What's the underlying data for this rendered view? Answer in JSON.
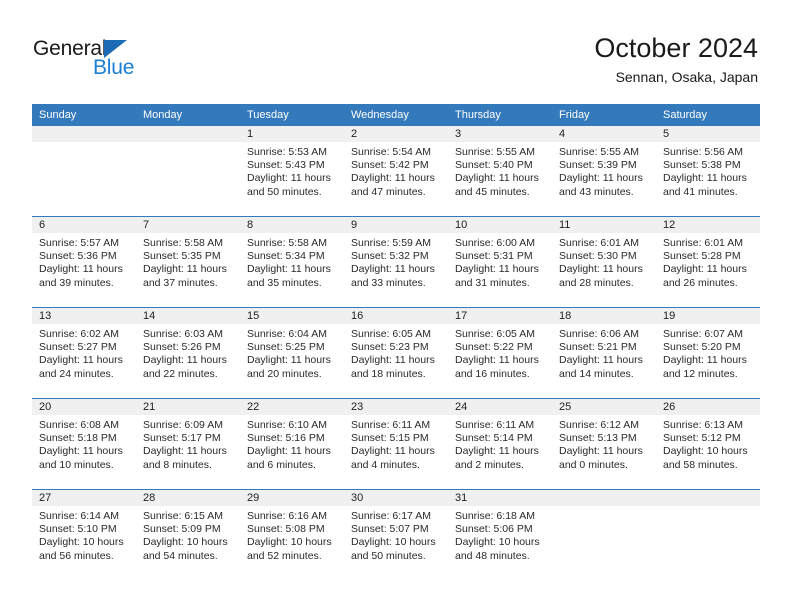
{
  "brand": {
    "name_top": "General",
    "name_bottom": "Blue",
    "triangle_color": "#1c6cb5",
    "bottom_color": "#1c7fd4"
  },
  "header": {
    "title": "October 2024",
    "subtitle": "Sennan, Osaka, Japan",
    "accent_color": "#3379bb",
    "daynum_band_color": "#f0f0f0"
  },
  "weekdays": [
    "Sunday",
    "Monday",
    "Tuesday",
    "Wednesday",
    "Thursday",
    "Friday",
    "Saturday"
  ],
  "weeks": [
    [
      {
        "day": "",
        "lines": []
      },
      {
        "day": "",
        "lines": []
      },
      {
        "day": "1",
        "lines": [
          "Sunrise: 5:53 AM",
          "Sunset: 5:43 PM",
          "Daylight: 11 hours",
          "and 50 minutes."
        ]
      },
      {
        "day": "2",
        "lines": [
          "Sunrise: 5:54 AM",
          "Sunset: 5:42 PM",
          "Daylight: 11 hours",
          "and 47 minutes."
        ]
      },
      {
        "day": "3",
        "lines": [
          "Sunrise: 5:55 AM",
          "Sunset: 5:40 PM",
          "Daylight: 11 hours",
          "and 45 minutes."
        ]
      },
      {
        "day": "4",
        "lines": [
          "Sunrise: 5:55 AM",
          "Sunset: 5:39 PM",
          "Daylight: 11 hours",
          "and 43 minutes."
        ]
      },
      {
        "day": "5",
        "lines": [
          "Sunrise: 5:56 AM",
          "Sunset: 5:38 PM",
          "Daylight: 11 hours",
          "and 41 minutes."
        ]
      }
    ],
    [
      {
        "day": "6",
        "lines": [
          "Sunrise: 5:57 AM",
          "Sunset: 5:36 PM",
          "Daylight: 11 hours",
          "and 39 minutes."
        ]
      },
      {
        "day": "7",
        "lines": [
          "Sunrise: 5:58 AM",
          "Sunset: 5:35 PM",
          "Daylight: 11 hours",
          "and 37 minutes."
        ]
      },
      {
        "day": "8",
        "lines": [
          "Sunrise: 5:58 AM",
          "Sunset: 5:34 PM",
          "Daylight: 11 hours",
          "and 35 minutes."
        ]
      },
      {
        "day": "9",
        "lines": [
          "Sunrise: 5:59 AM",
          "Sunset: 5:32 PM",
          "Daylight: 11 hours",
          "and 33 minutes."
        ]
      },
      {
        "day": "10",
        "lines": [
          "Sunrise: 6:00 AM",
          "Sunset: 5:31 PM",
          "Daylight: 11 hours",
          "and 31 minutes."
        ]
      },
      {
        "day": "11",
        "lines": [
          "Sunrise: 6:01 AM",
          "Sunset: 5:30 PM",
          "Daylight: 11 hours",
          "and 28 minutes."
        ]
      },
      {
        "day": "12",
        "lines": [
          "Sunrise: 6:01 AM",
          "Sunset: 5:28 PM",
          "Daylight: 11 hours",
          "and 26 minutes."
        ]
      }
    ],
    [
      {
        "day": "13",
        "lines": [
          "Sunrise: 6:02 AM",
          "Sunset: 5:27 PM",
          "Daylight: 11 hours",
          "and 24 minutes."
        ]
      },
      {
        "day": "14",
        "lines": [
          "Sunrise: 6:03 AM",
          "Sunset: 5:26 PM",
          "Daylight: 11 hours",
          "and 22 minutes."
        ]
      },
      {
        "day": "15",
        "lines": [
          "Sunrise: 6:04 AM",
          "Sunset: 5:25 PM",
          "Daylight: 11 hours",
          "and 20 minutes."
        ]
      },
      {
        "day": "16",
        "lines": [
          "Sunrise: 6:05 AM",
          "Sunset: 5:23 PM",
          "Daylight: 11 hours",
          "and 18 minutes."
        ]
      },
      {
        "day": "17",
        "lines": [
          "Sunrise: 6:05 AM",
          "Sunset: 5:22 PM",
          "Daylight: 11 hours",
          "and 16 minutes."
        ]
      },
      {
        "day": "18",
        "lines": [
          "Sunrise: 6:06 AM",
          "Sunset: 5:21 PM",
          "Daylight: 11 hours",
          "and 14 minutes."
        ]
      },
      {
        "day": "19",
        "lines": [
          "Sunrise: 6:07 AM",
          "Sunset: 5:20 PM",
          "Daylight: 11 hours",
          "and 12 minutes."
        ]
      }
    ],
    [
      {
        "day": "20",
        "lines": [
          "Sunrise: 6:08 AM",
          "Sunset: 5:18 PM",
          "Daylight: 11 hours",
          "and 10 minutes."
        ]
      },
      {
        "day": "21",
        "lines": [
          "Sunrise: 6:09 AM",
          "Sunset: 5:17 PM",
          "Daylight: 11 hours",
          "and 8 minutes."
        ]
      },
      {
        "day": "22",
        "lines": [
          "Sunrise: 6:10 AM",
          "Sunset: 5:16 PM",
          "Daylight: 11 hours",
          "and 6 minutes."
        ]
      },
      {
        "day": "23",
        "lines": [
          "Sunrise: 6:11 AM",
          "Sunset: 5:15 PM",
          "Daylight: 11 hours",
          "and 4 minutes."
        ]
      },
      {
        "day": "24",
        "lines": [
          "Sunrise: 6:11 AM",
          "Sunset: 5:14 PM",
          "Daylight: 11 hours",
          "and 2 minutes."
        ]
      },
      {
        "day": "25",
        "lines": [
          "Sunrise: 6:12 AM",
          "Sunset: 5:13 PM",
          "Daylight: 11 hours",
          "and 0 minutes."
        ]
      },
      {
        "day": "26",
        "lines": [
          "Sunrise: 6:13 AM",
          "Sunset: 5:12 PM",
          "Daylight: 10 hours",
          "and 58 minutes."
        ]
      }
    ],
    [
      {
        "day": "27",
        "lines": [
          "Sunrise: 6:14 AM",
          "Sunset: 5:10 PM",
          "Daylight: 10 hours",
          "and 56 minutes."
        ]
      },
      {
        "day": "28",
        "lines": [
          "Sunrise: 6:15 AM",
          "Sunset: 5:09 PM",
          "Daylight: 10 hours",
          "and 54 minutes."
        ]
      },
      {
        "day": "29",
        "lines": [
          "Sunrise: 6:16 AM",
          "Sunset: 5:08 PM",
          "Daylight: 10 hours",
          "and 52 minutes."
        ]
      },
      {
        "day": "30",
        "lines": [
          "Sunrise: 6:17 AM",
          "Sunset: 5:07 PM",
          "Daylight: 10 hours",
          "and 50 minutes."
        ]
      },
      {
        "day": "31",
        "lines": [
          "Sunrise: 6:18 AM",
          "Sunset: 5:06 PM",
          "Daylight: 10 hours",
          "and 48 minutes."
        ]
      },
      {
        "day": "",
        "lines": []
      },
      {
        "day": "",
        "lines": []
      }
    ]
  ]
}
